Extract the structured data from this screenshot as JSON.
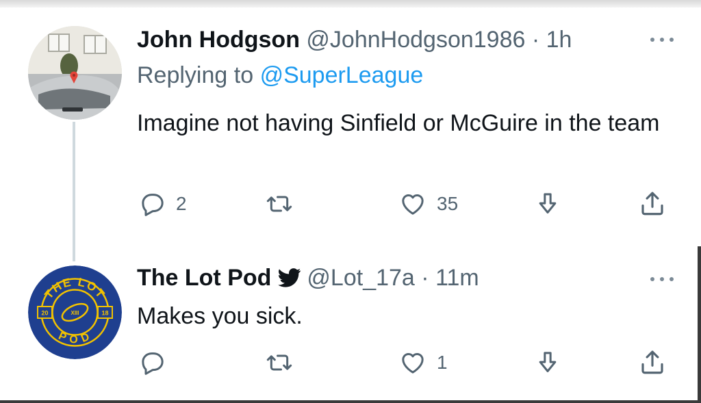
{
  "tweets": [
    {
      "name": "John Hodgson",
      "handle": "@JohnHodgson1986",
      "separator": "·",
      "time": "1h",
      "replying_prefix": "Replying to",
      "replying_mention": "@SuperLeague",
      "text": "Imagine not having Sinfield or McGuire in the team",
      "verified": false,
      "actions": {
        "reply_count": "2",
        "retweet_count": "",
        "like_count": "35"
      }
    },
    {
      "name": "The Lot Pod",
      "handle": "@Lot_17a",
      "separator": "·",
      "time": "11m",
      "text": "Makes you sick.",
      "verified": true,
      "verified_icon": "twitter-bird-icon",
      "actions": {
        "reply_count": "",
        "retweet_count": "",
        "like_count": "1"
      },
      "avatar_logo": {
        "top_text": "THE LOT",
        "bottom_text": "POD",
        "left_text": "20",
        "right_text": "18",
        "center_text": "XIII"
      }
    }
  ],
  "colors": {
    "link": "#1d9bf0",
    "secondary": "#536471",
    "primary": "#0f1419",
    "thread_line": "#cfd9de",
    "logo_blue": "#1f3f8f",
    "logo_yellow": "#f2c200"
  }
}
